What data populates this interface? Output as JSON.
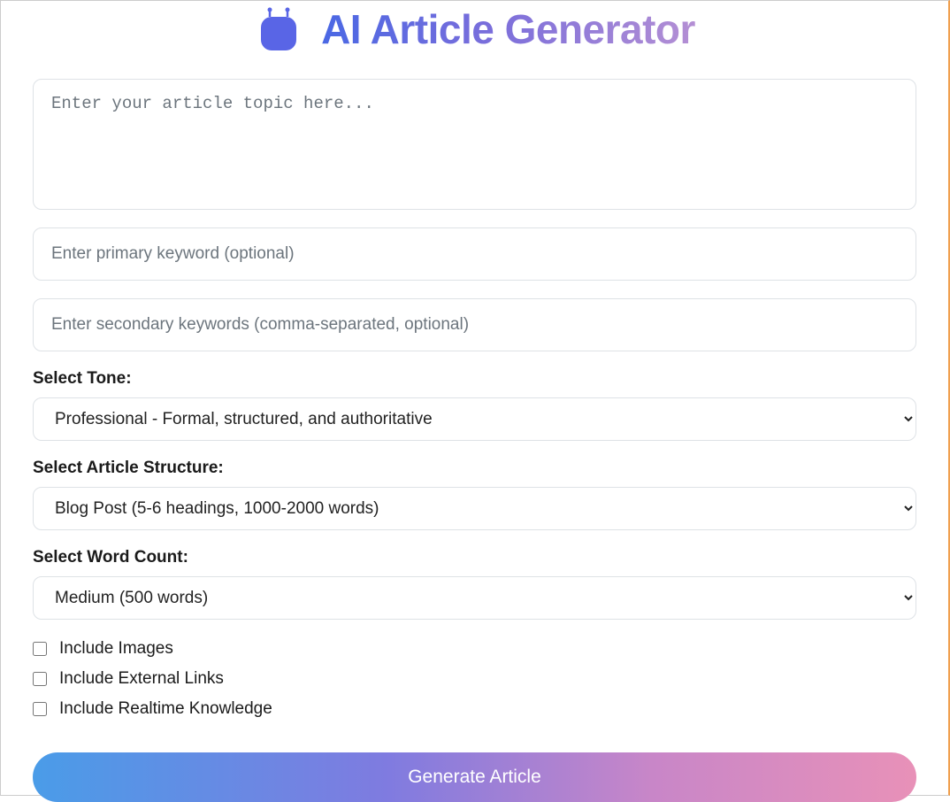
{
  "header": {
    "title": "AI Article Generator"
  },
  "form": {
    "topic_placeholder": "Enter your article topic here...",
    "primary_keyword_placeholder": "Enter primary keyword (optional)",
    "secondary_keywords_placeholder": "Enter secondary keywords (comma-separated, optional)",
    "tone": {
      "label": "Select Tone:",
      "selected": "Professional - Formal, structured, and authoritative"
    },
    "structure": {
      "label": "Select Article Structure:",
      "selected": "Blog Post (5-6 headings, 1000-2000 words)"
    },
    "word_count": {
      "label": "Select Word Count:",
      "selected": "Medium (500 words)"
    },
    "checkboxes": {
      "images": "Include Images",
      "external_links": "Include External Links",
      "realtime": "Include Realtime Knowledge"
    },
    "generate_label": "Generate Article"
  }
}
